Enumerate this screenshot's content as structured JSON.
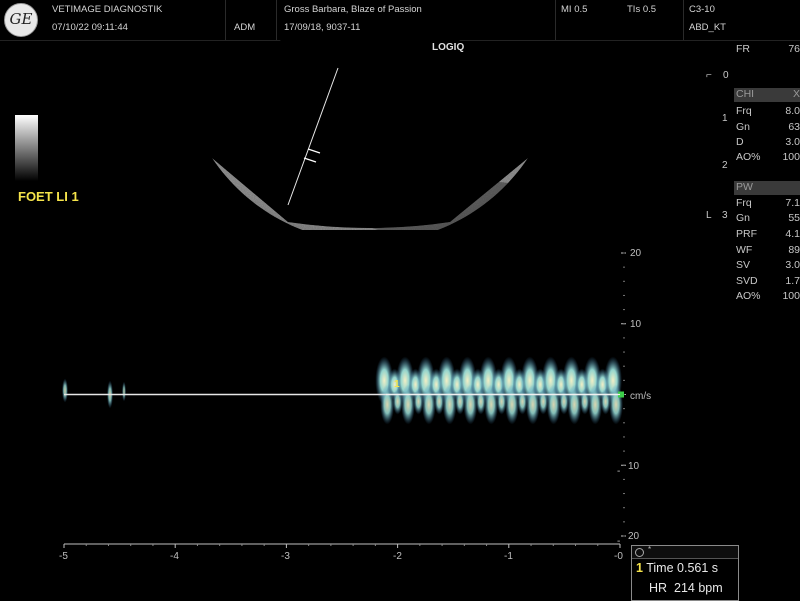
{
  "header": {
    "logo_text": "GE",
    "clinic": "VETIMAGE DIAGNOSTIK",
    "datetime": "07/10/22 09:11:44",
    "operator": "ADM",
    "patient": "Gross Barbara, Blaze of Passion",
    "patient_id": "17/09/18, 9037-11",
    "mi": "MI 0.5",
    "tis": "TIs 0.5",
    "probe": "C3-10",
    "preset": "ABD_KT"
  },
  "image_labels": {
    "logiq": "LOGIQ",
    "foet": "FOET LI 1"
  },
  "depth_marks": [
    "0",
    "1",
    "2",
    "3"
  ],
  "params": {
    "fr": {
      "label": "FR",
      "value": "76"
    },
    "chi_header": {
      "label": "CHI",
      "value": "X"
    },
    "chi": [
      {
        "label": "Frq",
        "value": "8.0"
      },
      {
        "label": "Gn",
        "value": "63"
      },
      {
        "label": "D",
        "value": "3.0"
      },
      {
        "label": "AO%",
        "value": "100"
      }
    ],
    "pw_header": {
      "label": "PW"
    },
    "pw": [
      {
        "label": "Frq",
        "value": "7.1"
      },
      {
        "label": "Gn",
        "value": "55"
      },
      {
        "label": "PRF",
        "value": "4.1"
      },
      {
        "label": "WF",
        "value": "89"
      },
      {
        "label": "SV",
        "value": "3.0"
      },
      {
        "label": "SVD",
        "value": "1.7"
      },
      {
        "label": "AO%",
        "value": "100"
      }
    ]
  },
  "chart_data": {
    "type": "area",
    "xlabel": "",
    "ylabel": "cm/s",
    "xlim": [
      -5,
      0
    ],
    "ylim": [
      -20,
      20
    ],
    "x_ticks": [
      "-5",
      "-4",
      "-3",
      "-2",
      "-1",
      "-0"
    ],
    "y_ticks": [
      "20",
      "10",
      "10",
      "20"
    ],
    "baseline": 0,
    "grid": false
  },
  "measurement": {
    "tag": "*",
    "index": "1",
    "time_label": "Time",
    "time_value": "0.561 s",
    "hr_label": "HR",
    "hr_value": "214 bpm"
  },
  "colors": {
    "spectrum_core": "#fffbd0",
    "spectrum_mid": "#9be0d8",
    "spectrum_edge": "#3a7fb0",
    "caliper": "#f5e34a"
  }
}
